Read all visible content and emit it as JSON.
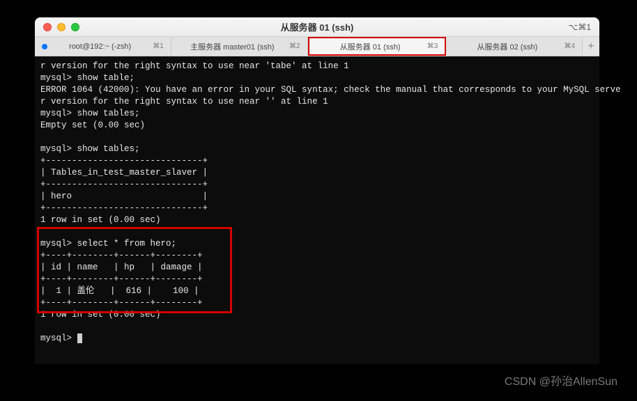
{
  "window": {
    "title": "从服务器 01 (ssh)",
    "shortcut_hint": "⌥⌘1"
  },
  "tabs": [
    {
      "label": "root@192:~ (-zsh)",
      "shortcut": "⌘1",
      "has_status": true,
      "active": false
    },
    {
      "label": "主服务器 master01 (ssh)",
      "shortcut": "⌘2",
      "has_status": false,
      "active": false
    },
    {
      "label": "从服务器 01 (ssh)",
      "shortcut": "⌘3",
      "has_status": false,
      "active": true
    },
    {
      "label": "从服务器 02 (ssh)",
      "shortcut": "⌘4",
      "has_status": false,
      "active": false
    }
  ],
  "add_tab_glyph": "+",
  "terminal": {
    "lines": [
      "r version for the right syntax to use near 'tabe' at line 1",
      "mysql> show table;",
      "ERROR 1064 (42000): You have an error in your SQL syntax; check the manual that corresponds to your MySQL serve",
      "r version for the right syntax to use near '' at line 1",
      "mysql> show tables;",
      "Empty set (0.00 sec)",
      "",
      "mysql> show tables;",
      "+------------------------------+",
      "| Tables_in_test_master_slaver |",
      "+------------------------------+",
      "| hero                         |",
      "+------------------------------+",
      "1 row in set (0.00 sec)",
      "",
      "mysql> select * from hero;",
      "+----+--------+------+--------+",
      "| id | name   | hp   | damage |",
      "+----+--------+------+--------+",
      "|  1 | 盖伦   |  616 |    100 |",
      "+----+--------+------+--------+",
      "1 row in set (0.00 sec)",
      "",
      "mysql> "
    ],
    "prompt_cursor": true
  },
  "watermark": "CSDN @孙治AllenSun"
}
